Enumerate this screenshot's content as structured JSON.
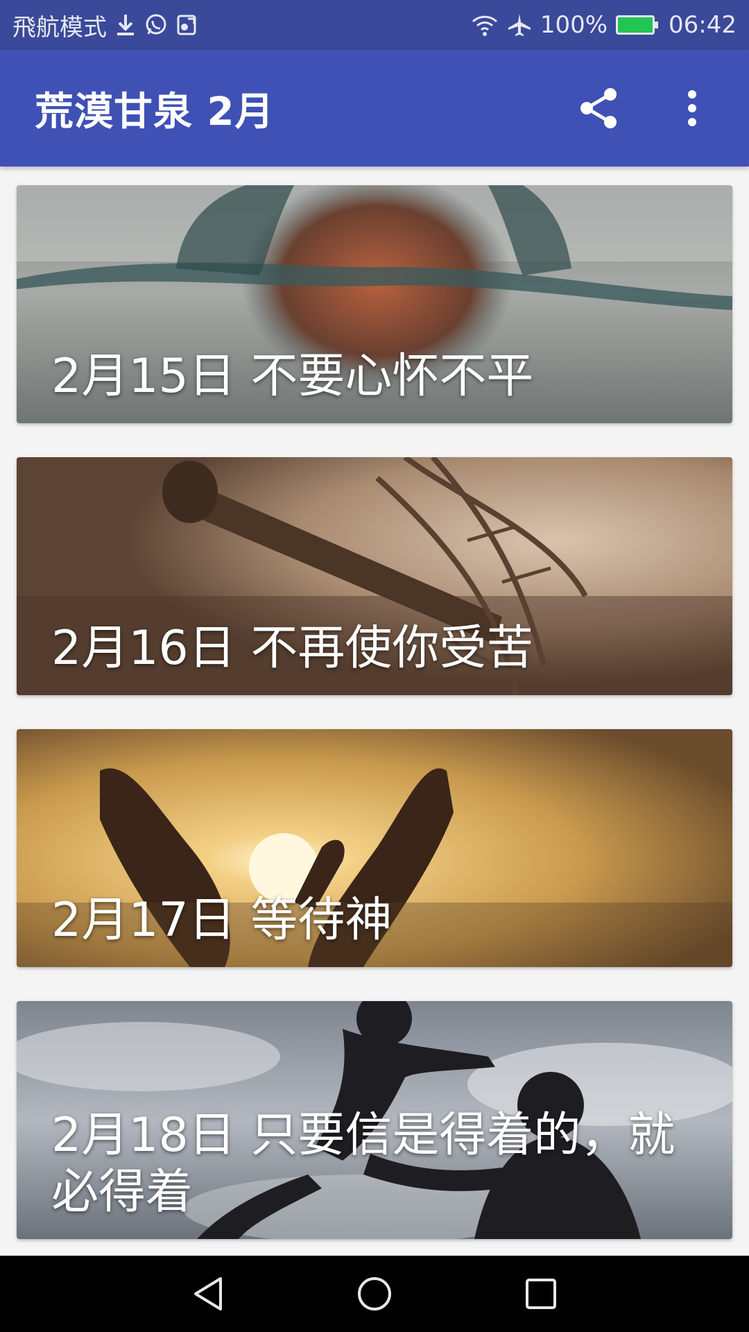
{
  "status_bar": {
    "mode_text": "飛航模式",
    "battery": "100%",
    "time": "06:42",
    "icons": [
      "download-icon",
      "whatsapp-icon",
      "gallery-icon",
      "wifi-icon",
      "airplane-icon",
      "battery-icon"
    ],
    "battery_color": "#23c552"
  },
  "app_bar": {
    "title": "荒漠甘泉 2月",
    "color": "#3f51b5",
    "actions": [
      "share-icon",
      "more-vert-icon"
    ]
  },
  "cards": [
    {
      "title": "2月15日 不要心怀不平"
    },
    {
      "title": "2月16日 不再使你受苦"
    },
    {
      "title": "2月17日 等待神"
    },
    {
      "title": "2月18日 只要信是得着的，就必得着"
    }
  ],
  "nav_bar": {
    "buttons": [
      "back-icon",
      "home-icon",
      "recents-icon"
    ]
  }
}
